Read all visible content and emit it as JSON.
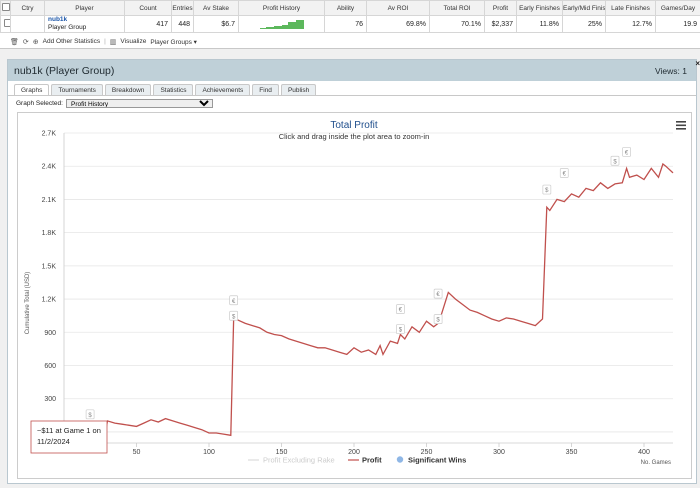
{
  "stats_table": {
    "headers": [
      "Ctry",
      "Player",
      "Count",
      "Entries",
      "Av Stake",
      "Profit History",
      "Ability",
      "Av ROI",
      "Total ROI",
      "Profit",
      "Early Finishes",
      "Early/Mid Finishes",
      "Late Finishes",
      "Games/Day"
    ],
    "row": {
      "player_name": "nub1k",
      "player_type": "Player Group",
      "count": "417",
      "entries": "448",
      "av_stake": "$6.7",
      "ability": "76",
      "av_roi": "69.8%",
      "total_roi": "70.1%",
      "profit": "$2,337",
      "early_finishes": "11.8%",
      "early_mid_finishes": "25%",
      "late_finishes": "12.7%",
      "games_per_day": "19.9"
    }
  },
  "toolbar": {
    "add_other_statistics": "Add Other Statistics",
    "visualize": "Visualize",
    "player_groups": "Player Groups ▾"
  },
  "panel": {
    "title": "nub1k (Player Group)",
    "views": "Views: 1",
    "close": "×",
    "tabs": [
      "Graphs",
      "Tournaments",
      "Breakdown",
      "Statistics",
      "Achievements",
      "Find",
      "Publish"
    ],
    "graph_selected_label": "Graph Selected:",
    "graph_selected_value": "Profit History"
  },
  "chart_data": {
    "type": "line",
    "title": "Total Profit",
    "subtitle": "Click and drag inside the plot area to zoom-in",
    "ylabel": "Cumulative Total (USD)",
    "xlabel": "No. Games",
    "ylim": [
      -100,
      2700
    ],
    "xlim": [
      0,
      420
    ],
    "yticks": [
      "0",
      "300",
      "600",
      "900",
      "1.2K",
      "1.5K",
      "1.8K",
      "2.1K",
      "2.4K",
      "2.7K"
    ],
    "ytick_values": [
      0,
      300,
      600,
      900,
      1200,
      1500,
      1800,
      2100,
      2400,
      2700
    ],
    "xticks": [
      "50",
      "100",
      "150",
      "200",
      "250",
      "300",
      "350",
      "400"
    ],
    "xtick_values": [
      50,
      100,
      150,
      200,
      250,
      300,
      350,
      400
    ],
    "legend": [
      "Profit Excluding Rake",
      "Profit",
      "Significant Wins"
    ],
    "line_color": "#c0504d",
    "marker_color": "#8fb7e6",
    "tooltip": [
      "~$11 at Game 1 on",
      "11/2/2024"
    ],
    "series": [
      {
        "name": "Profit",
        "x": [
          0,
          5,
          10,
          15,
          18,
          20,
          22,
          25,
          28,
          30,
          35,
          40,
          45,
          50,
          55,
          60,
          65,
          70,
          75,
          80,
          85,
          90,
          95,
          100,
          105,
          110,
          115,
          117,
          120,
          125,
          130,
          135,
          140,
          145,
          150,
          155,
          160,
          165,
          170,
          175,
          180,
          185,
          190,
          195,
          200,
          205,
          210,
          215,
          218,
          220,
          225,
          230,
          232,
          235,
          240,
          245,
          250,
          255,
          258,
          260,
          265,
          270,
          275,
          280,
          285,
          290,
          295,
          300,
          305,
          310,
          315,
          320,
          325,
          330,
          333,
          335,
          340,
          345,
          350,
          355,
          360,
          365,
          370,
          375,
          380,
          385,
          388,
          390,
          395,
          400,
          405,
          410,
          413,
          415,
          420
        ],
        "y": [
          11,
          -5,
          -20,
          -35,
          -20,
          -30,
          -10,
          -30,
          -35,
          100,
          80,
          70,
          60,
          50,
          80,
          110,
          90,
          120,
          100,
          80,
          60,
          40,
          20,
          -10,
          -10,
          -20,
          -30,
          1040,
          1010,
          980,
          960,
          940,
          900,
          880,
          870,
          840,
          820,
          800,
          780,
          760,
          760,
          740,
          720,
          700,
          760,
          720,
          740,
          700,
          780,
          700,
          820,
          800,
          880,
          840,
          950,
          900,
          1000,
          950,
          980,
          1050,
          1260,
          1200,
          1150,
          1100,
          1080,
          1050,
          1020,
          1000,
          1030,
          1020,
          1000,
          980,
          960,
          1020,
          2030,
          2000,
          2100,
          2080,
          2150,
          2120,
          2200,
          2180,
          2250,
          2200,
          2240,
          2250,
          2380,
          2300,
          2320,
          2280,
          2380,
          2300,
          2420,
          2400,
          2340
        ]
      }
    ],
    "significant_wins": [
      {
        "x": 18,
        "y": 150,
        "label": "$"
      },
      {
        "x": 117,
        "y": 1040,
        "label": "$"
      },
      {
        "x": 117,
        "y": 1180,
        "label": "€"
      },
      {
        "x": 232,
        "y": 920,
        "label": "$"
      },
      {
        "x": 232,
        "y": 1100,
        "label": "€"
      },
      {
        "x": 258,
        "y": 1010,
        "label": "$"
      },
      {
        "x": 258,
        "y": 1240,
        "label": "€"
      },
      {
        "x": 333,
        "y": 2180,
        "label": "$"
      },
      {
        "x": 345,
        "y": 2330,
        "label": "€"
      },
      {
        "x": 380,
        "y": 2440,
        "label": "$"
      },
      {
        "x": 388,
        "y": 2520,
        "label": "€"
      }
    ]
  }
}
